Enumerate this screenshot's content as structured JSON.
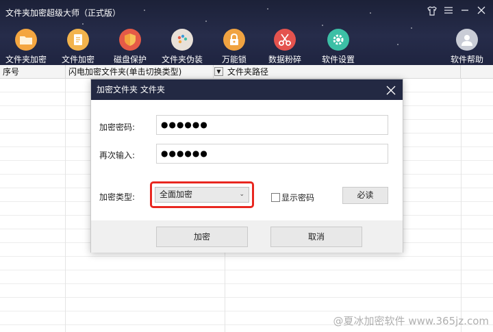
{
  "app": {
    "title": "文件夹加密超级大师（正式版）"
  },
  "window_controls": [
    "shirt-icon",
    "menu-icon",
    "minimize-icon",
    "close-icon"
  ],
  "toolbar": {
    "items": [
      {
        "label": "文件夹加密",
        "icon": "folder-icon",
        "color": "#f4a640"
      },
      {
        "label": "文件加密",
        "icon": "document-icon",
        "color": "#f2b34c"
      },
      {
        "label": "磁盘保护",
        "icon": "shield-icon",
        "color": "#e55a47"
      },
      {
        "label": "文件夹伪装",
        "icon": "palette-icon",
        "color": "#e8e0d8"
      },
      {
        "label": "万能锁",
        "icon": "lock-icon",
        "color": "#f0a341"
      },
      {
        "label": "数据粉碎",
        "icon": "scissors-icon",
        "color": "#e4534e"
      },
      {
        "label": "软件设置",
        "icon": "gear-icon",
        "color": "#3cbfa6"
      },
      {
        "label": "软件帮助",
        "icon": "user-help-icon",
        "color": "#c9ccd6"
      }
    ]
  },
  "table": {
    "columns": [
      "序号",
      "闪电加密文件夹(单击切换类型)",
      "文件夹路径"
    ],
    "dropdown_icon": "triangle-down-icon"
  },
  "dialog": {
    "title": "加密文件夹 文件夹",
    "password_label": "加密密码:",
    "password_value": "●●●●●●",
    "confirm_label": "再次输入:",
    "confirm_value": "●●●●●●",
    "type_label": "加密类型:",
    "type_value": "全面加密",
    "show_password_label": "显示密码",
    "show_password_checked": false,
    "must_read_label": "必读",
    "encrypt_label": "加密",
    "cancel_label": "取消",
    "highlight_color": "#e8261f"
  },
  "watermark": "@夏冰加密软件 www.365jz.com"
}
